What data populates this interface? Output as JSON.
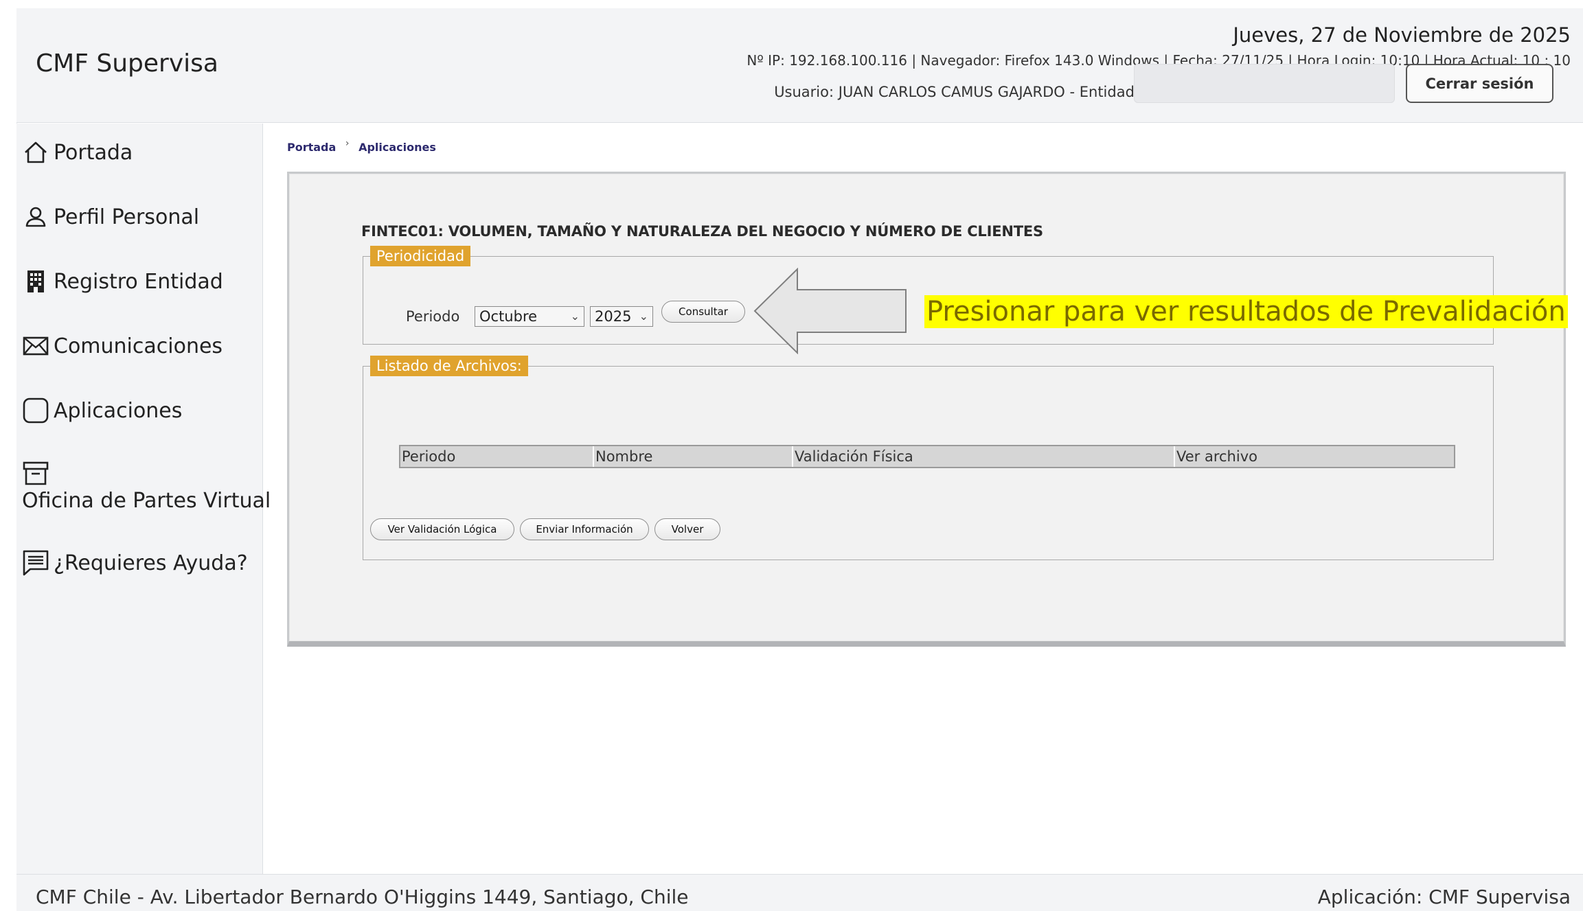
{
  "header": {
    "brand": "CMF Supervisa",
    "date": "Jueves, 27 de Noviembre de 2025",
    "info": "Nº IP: 192.168.100.116 | Navegador: Firefox 143.0 Windows | Fecha: 27/11/25 | Hora Login: 10:10 | Hora Actual: 10 : 10",
    "user": "Usuario: JUAN CARLOS CAMUS GAJARDO - Entidad:",
    "entity_value": "",
    "logout_label": "Cerrar sesión"
  },
  "sidebar": {
    "items": [
      {
        "label": "Portada",
        "icon": "home-icon"
      },
      {
        "label": "Perfil Personal",
        "icon": "user-icon"
      },
      {
        "label": "Registro Entidad",
        "icon": "building-icon"
      },
      {
        "label": "Comunicaciones",
        "icon": "envelope-icon"
      },
      {
        "label": "Aplicaciones",
        "icon": "square-icon"
      },
      {
        "label": "Oficina de Partes Virtual",
        "icon": "archive-icon"
      },
      {
        "label": "¿Requieres Ayuda?",
        "icon": "message-icon"
      }
    ]
  },
  "breadcrumb": {
    "home": "Portada",
    "sep": "›",
    "current": "Aplicaciones"
  },
  "app": {
    "title": "FINTEC01: VOLUMEN, TAMAÑO Y NATURALEZA DEL NEGOCIO Y NÚMERO DE CLIENTES",
    "periodicidad": {
      "legend": "Periodicidad",
      "periodo_label": "Periodo",
      "month_selected": "Octubre",
      "year_selected": "2025",
      "consultar_label": "Consultar"
    },
    "hint": "Presionar para ver resultados de Prevalidación",
    "listado": {
      "legend": "Listado de Archivos:",
      "columns": [
        "Periodo",
        "Nombre",
        "Validación Física",
        "Ver archivo"
      ],
      "rows": []
    },
    "buttons": {
      "ver_validacion": "Ver Validación Lógica",
      "enviar": "Enviar Información",
      "volver": "Volver"
    }
  },
  "footer": {
    "address": "CMF Chile - Av. Libertador Bernardo O'Higgins 1449, Santiago, Chile",
    "app": "Aplicación: CMF Supervisa"
  },
  "colors": {
    "legend_bg": "#e0a32e",
    "hint_bg": "#ffff00",
    "breadcrumb": "#2d2a6e"
  }
}
